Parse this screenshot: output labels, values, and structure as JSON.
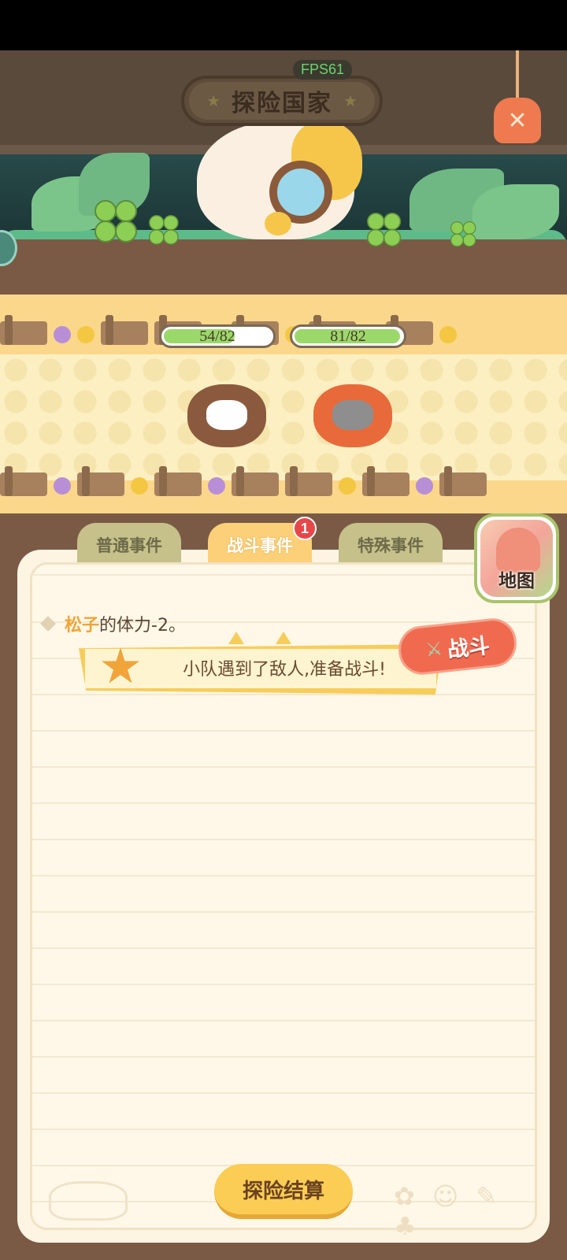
{
  "header": {
    "title": "探险国家",
    "fps": "FPS61"
  },
  "battle": {
    "ally_hp": {
      "text": "54/82",
      "value": 54,
      "max": 82
    },
    "enemy_hp": {
      "text": "81/82",
      "value": 81,
      "max": 82
    }
  },
  "tabs": [
    {
      "label": "普通事件",
      "active": false
    },
    {
      "label": "战斗事件",
      "active": true,
      "badge": "1"
    },
    {
      "label": "特殊事件",
      "active": false
    }
  ],
  "map_button": {
    "label": "地图"
  },
  "log": {
    "name": "松子",
    "text": "的体力-2。"
  },
  "event": {
    "text": "小队遇到了敌人,准备战斗!",
    "tag": "战斗"
  },
  "settle_button": {
    "label": "探险结算"
  },
  "colors": {
    "hp_fill": "#9bd86a",
    "badge": "#e8474a",
    "accent": "#fbcd54",
    "battle_tag": "#ef6a4f"
  }
}
